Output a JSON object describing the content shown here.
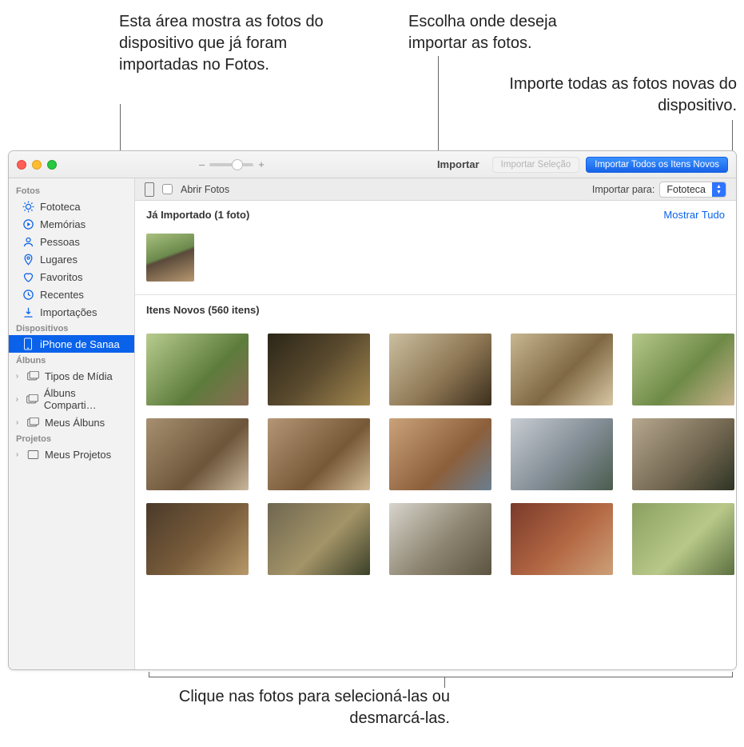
{
  "callouts": {
    "imported_area": "Esta área mostra as fotos do dispositivo que já foram importadas no Fotos.",
    "choose_dest": "Escolha onde deseja importar as fotos.",
    "import_all": "Importe todas as fotos novas do dispositivo.",
    "click_select": "Clique nas fotos para selecioná-las ou desmarcá-las."
  },
  "toolbar": {
    "title": "Importar",
    "import_selection": "Importar Seleção",
    "import_all_new": "Importar Todos os Itens Novos",
    "zoom_minus": "–",
    "zoom_plus": "+"
  },
  "options": {
    "open_photos": "Abrir Fotos",
    "import_to_label": "Importar para:",
    "import_to_value": "Fototeca"
  },
  "sidebar": {
    "fotos_heading": "Fotos",
    "items": [
      {
        "label": "Fototeca",
        "icon": "library"
      },
      {
        "label": "Memórias",
        "icon": "memories"
      },
      {
        "label": "Pessoas",
        "icon": "people"
      },
      {
        "label": "Lugares",
        "icon": "places"
      },
      {
        "label": "Favoritos",
        "icon": "heart"
      },
      {
        "label": "Recentes",
        "icon": "clock"
      },
      {
        "label": "Importações",
        "icon": "import"
      }
    ],
    "devices_heading": "Dispositivos",
    "device": {
      "label": "iPhone de Sanaa",
      "icon": "phone"
    },
    "albums_heading": "Álbuns",
    "album_items": [
      {
        "label": "Tipos de Mídia"
      },
      {
        "label": "Álbuns Comparti…"
      },
      {
        "label": "Meus Álbuns"
      }
    ],
    "projects_heading": "Projetos",
    "project_items": [
      {
        "label": "Meus Projetos"
      }
    ]
  },
  "sections": {
    "already_imported": "Já Importado (1 foto)",
    "show_all": "Mostrar Tudo",
    "new_items": "Itens Novos (560 itens)"
  }
}
